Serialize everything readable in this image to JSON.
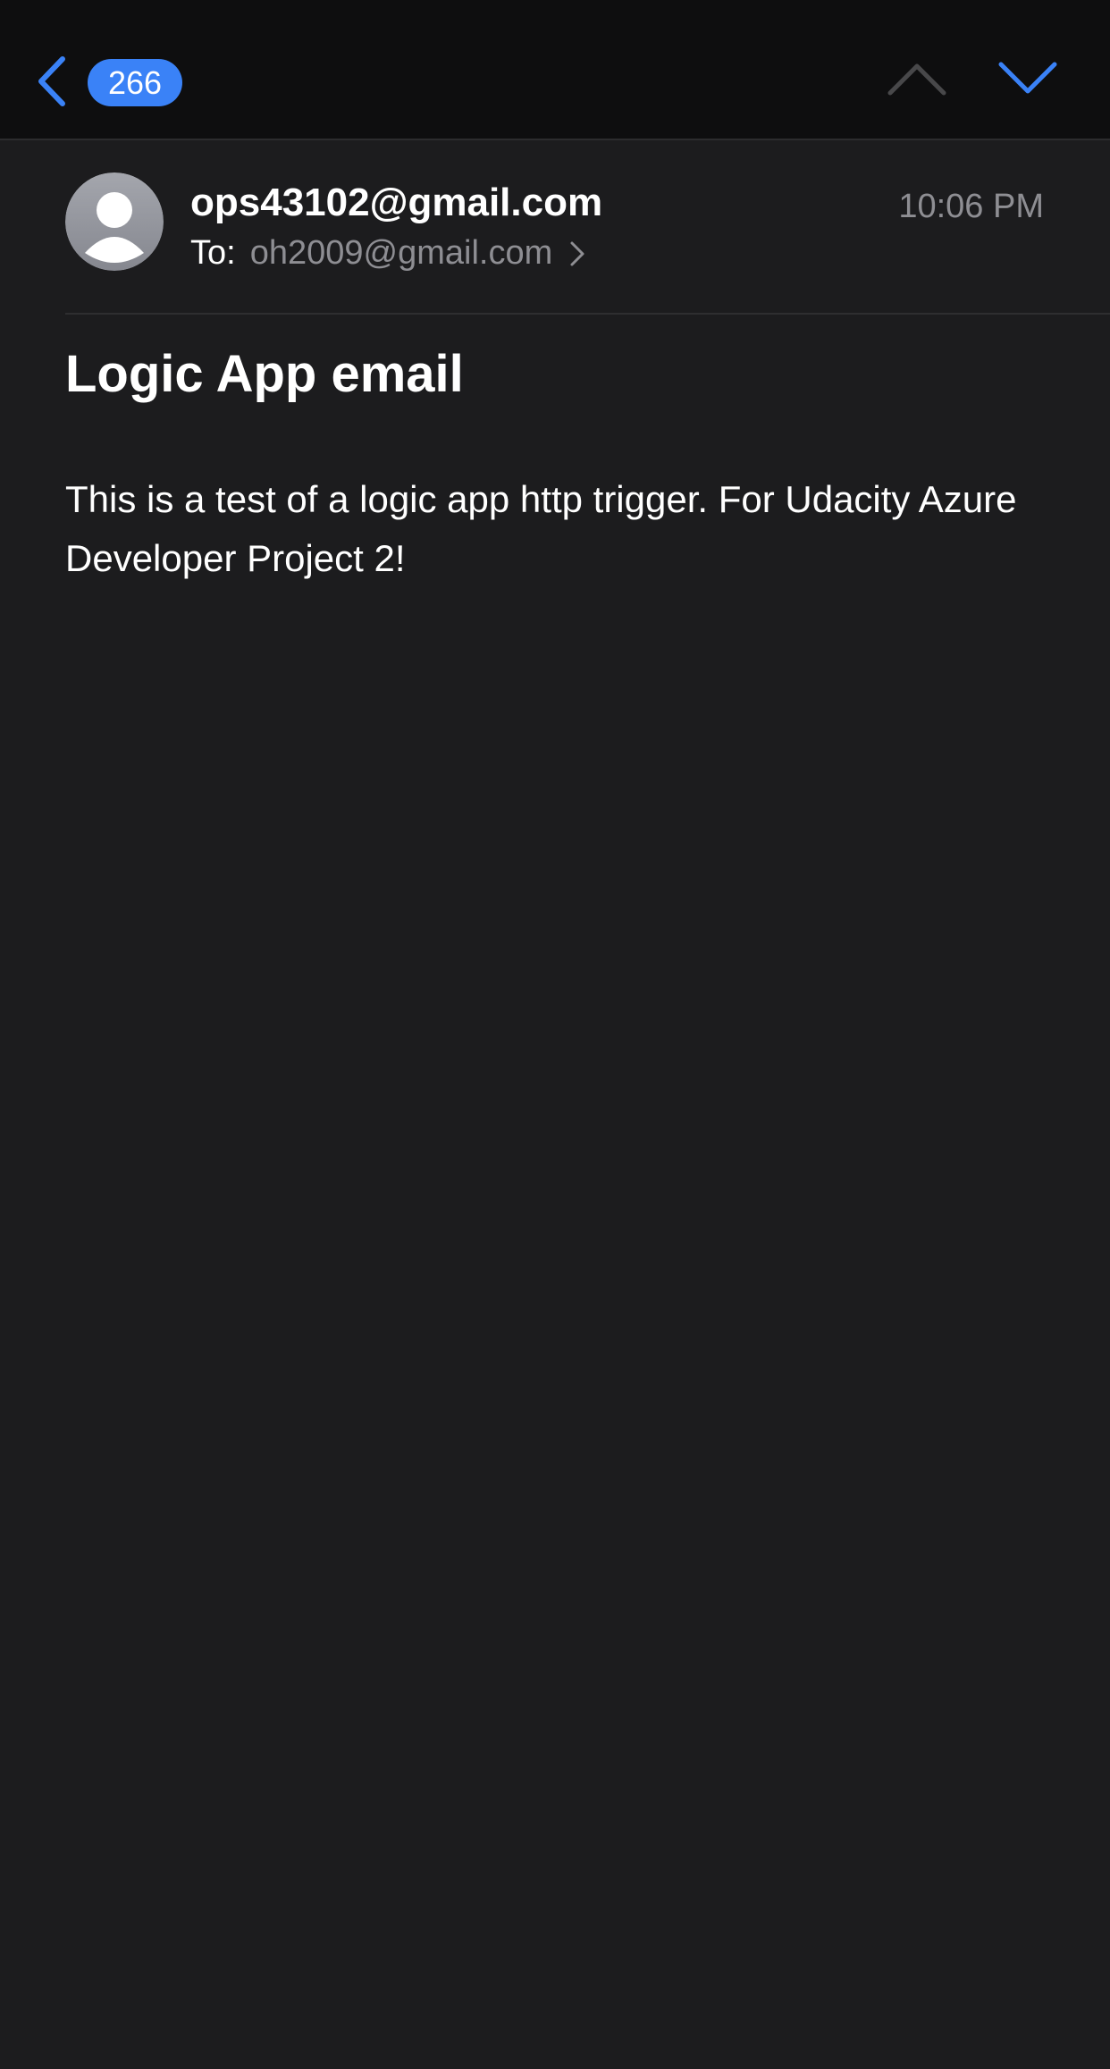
{
  "nav": {
    "unread_count": "266",
    "back_icon": "chevron-left-icon",
    "prev_icon": "chevron-up-icon",
    "next_icon": "chevron-down-icon",
    "accent_color": "#3a82f7",
    "prev_enabled": false,
    "next_enabled": true
  },
  "message": {
    "avatar_icon": "person-icon",
    "sender": "ops43102@gmail.com",
    "timestamp": "10:06 PM",
    "to_label": "To:",
    "to_address": "oh2009@gmail.com",
    "subject": "Logic App email",
    "body": "This is a test of a logic app http trigger. For Udacity Azure Developer Project 2!"
  }
}
